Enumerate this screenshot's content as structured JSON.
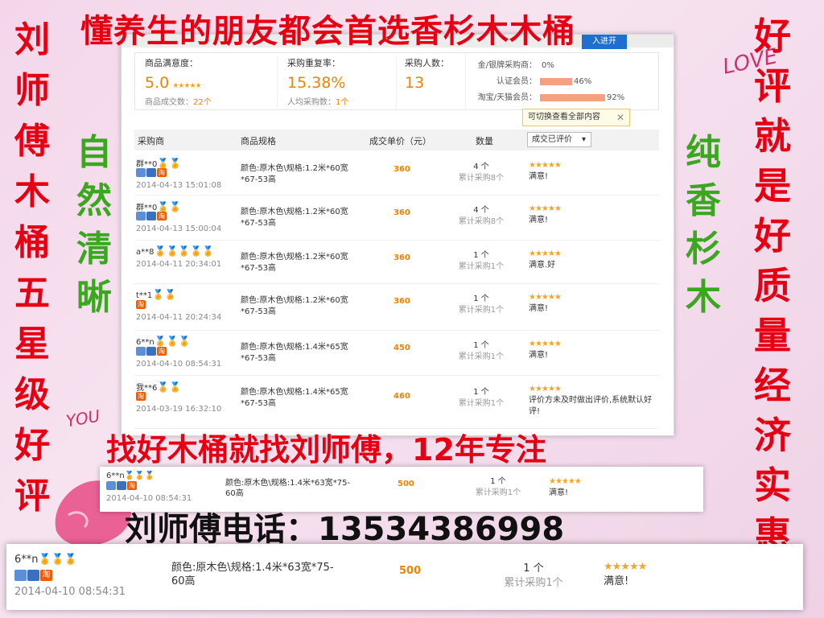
{
  "banner": {
    "top": "懂养生的朋友都会首选香杉木木桶"
  },
  "left_vertical": [
    "刘",
    "师",
    "傅",
    "木",
    "桶",
    "五",
    "星",
    "级",
    "好",
    "评"
  ],
  "right_vertical": [
    "好",
    "评",
    "就",
    "是",
    "好",
    "质",
    "量",
    "经",
    "济",
    "实",
    "惠"
  ],
  "green_left": [
    "自",
    "然",
    "清",
    "晰"
  ],
  "green_right": [
    "纯",
    "香",
    "杉",
    "木"
  ],
  "decor": {
    "love": "LOVE",
    "you": "YOU"
  },
  "topbar": {
    "join_label": "入进开"
  },
  "stats": {
    "satisfaction_label": "商品满意度：",
    "satisfaction_value": "5.0",
    "satisfaction_stars": "★★★★★",
    "deals_label": "商品成交数：",
    "deals_count": "22个",
    "repeat_label": "采购重复率：",
    "repeat_value": "15.38%",
    "avg_label": "人均采购数：",
    "avg_count": "1个",
    "buyers_label": "采购人数：",
    "buyers_value": "13"
  },
  "ratios": [
    {
      "label": "金/银牌采购商：",
      "value": "0%",
      "fraction": 0.0
    },
    {
      "label": "认证会员：",
      "value": "46%",
      "fraction": 0.46
    },
    {
      "label": "淘宝/天猫会员：",
      "value": "92%",
      "fraction": 0.92
    }
  ],
  "tooltip": {
    "text": "可切换查看全部内容",
    "close": "✕"
  },
  "table": {
    "headers": [
      "采购商",
      "商品规格",
      "成交单价（元）",
      "数量"
    ],
    "sort_label": "成交已评价",
    "sort_arrow": "▾"
  },
  "rows": [
    {
      "buyer": "群**0",
      "medals": "🏅🏅",
      "badges": [
        "b1",
        "b2",
        "tao"
      ],
      "date": "2014-04-13 15:01:08",
      "spec": "颜色:原木色\\规格:1.2米*60宽*67-53高",
      "price": "360",
      "qty": "4 个",
      "cumulative": "累计采购8个",
      "stars": "★★★★★",
      "comment": "满意!"
    },
    {
      "buyer": "群**0",
      "medals": "🏅🏅",
      "badges": [
        "b1",
        "b2",
        "tao"
      ],
      "date": "2014-04-13 15:00:04",
      "spec": "颜色:原木色\\规格:1.2米*60宽*67-53高",
      "price": "360",
      "qty": "4 个",
      "cumulative": "累计采购8个",
      "stars": "★★★★★",
      "comment": "满意!"
    },
    {
      "buyer": "a**8",
      "medals": "🏅🏅🏅🏅🏅",
      "badges": [],
      "date": "2014-04-11 20:34:01",
      "spec": "颜色:原木色\\规格:1.2米*60宽*67-53高",
      "price": "360",
      "qty": "1 个",
      "cumulative": "累计采购1个",
      "stars": "★★★★★",
      "comment": "满意.好"
    },
    {
      "buyer": "t**1",
      "medals": "🏅🏅",
      "badges": [
        "tao"
      ],
      "date": "2014-04-11 20:24:34",
      "spec": "颜色:原木色\\规格:1.2米*60宽*67-53高",
      "price": "360",
      "qty": "1 个",
      "cumulative": "累计采购1个",
      "stars": "★★★★★",
      "comment": "满意!"
    },
    {
      "buyer": "6**n",
      "medals": "🏅🏅🏅",
      "badges": [
        "b1",
        "b2",
        "tao"
      ],
      "date": "2014-04-10 08:54:31",
      "spec": "颜色:原木色\\规格:1.4米*65宽*67-53高",
      "price": "450",
      "qty": "1 个",
      "cumulative": "累计采购1个",
      "stars": "★★★★★",
      "comment": "满意!"
    },
    {
      "buyer": "我**6",
      "medals": "🏅🏅",
      "badges": [
        "tao"
      ],
      "date": "2014-03-19 16:32:10",
      "spec": "颜色:原木色\\规格:1.4米*65宽*67-53高",
      "price": "460",
      "qty": "1 个",
      "cumulative": "累计采购1个",
      "stars": "★★★★★",
      "comment": "评价方未及时做出评价,系统默认好评!"
    }
  ],
  "slogan": "找好木桶就找刘师傅，12年专注",
  "phone": "刘师傅电话：13534386998",
  "zoom_row": {
    "buyer": "6**n",
    "medals": "🏅🏅🏅",
    "badges": [
      "b1",
      "b2",
      "tao"
    ],
    "date": "2014-04-10 08:54:31",
    "spec": "颜色:原木色\\规格:1.4米*63宽*75-60高",
    "price": "500",
    "qty": "1 个",
    "cumulative": "累计采购1个",
    "stars": "★★★★★",
    "comment": "满意!"
  },
  "colors": {
    "accent_red": "#e60012",
    "accent_green": "#3aa81f",
    "price_orange": "#f08200",
    "background_pink": "#f4d6ea"
  }
}
